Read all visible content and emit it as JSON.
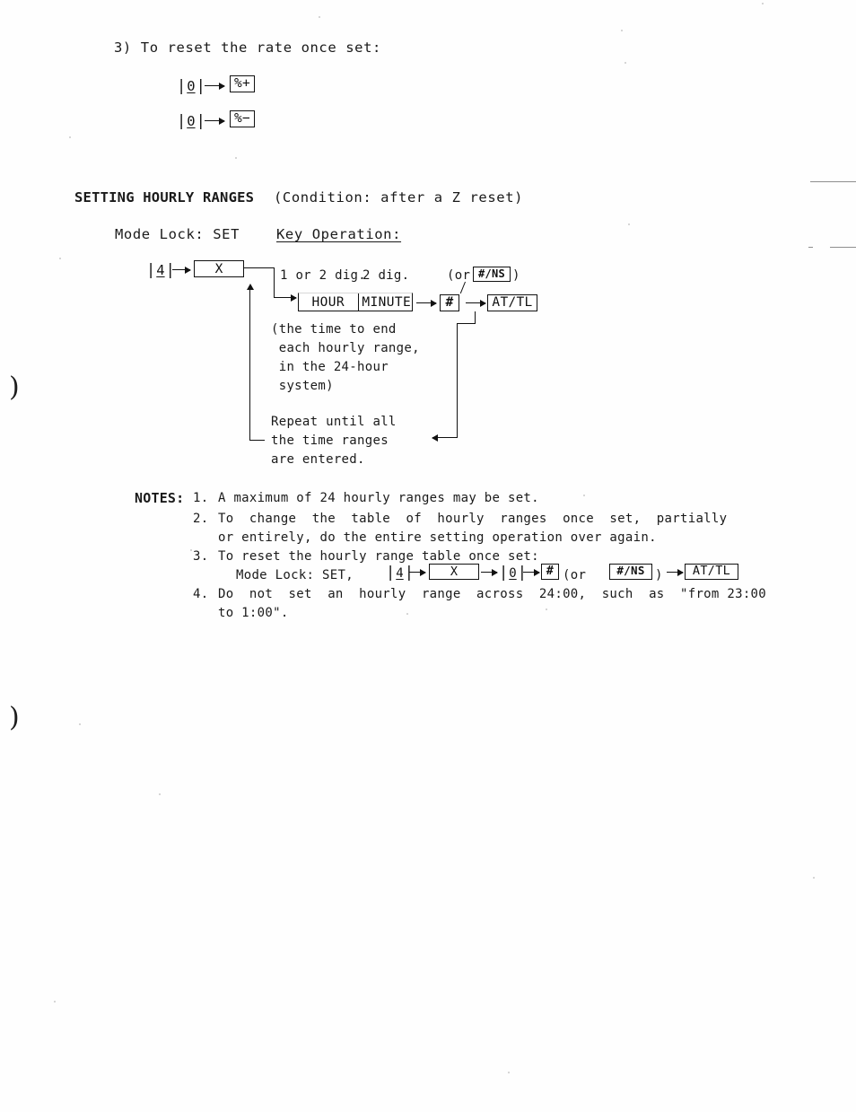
{
  "document": {
    "section_3": {
      "heading": "3) To reset the rate once set:",
      "lines": [
        {
          "key": "0",
          "arrow": "→",
          "target": "%+"
        },
        {
          "key": "0",
          "arrow": "→",
          "target": "%−"
        }
      ]
    },
    "section_hourly": {
      "title": "SETTING HOURLY RANGES",
      "condition": "(Condition: after a Z reset)",
      "mode_lock": "Mode Lock: SET",
      "key_operation_label": "Key Operation:",
      "diagram": {
        "start_key": "4",
        "x_box_label": "X",
        "digit_hint_1": "1 or 2 dig.",
        "digit_hint_2": "2 dig.",
        "or_note_open": "(or",
        "or_note_key": "#/NS",
        "or_note_close": ")",
        "hour_label": "HOUR",
        "minute_label": "MINUTE",
        "hash_key": "#",
        "attl_key": "AT/TL",
        "paren_note": [
          "(the time to end",
          " each hourly range,",
          " in the 24-hour",
          " system)"
        ],
        "repeat_note": [
          "Repeat until all",
          "the time ranges",
          "are entered."
        ]
      }
    },
    "notes": {
      "label": "NOTES:",
      "items": [
        {
          "number": "1.",
          "lines": [
            "A maximum of 24 hourly ranges may be set."
          ]
        },
        {
          "number": "2.",
          "lines": [
            "To  change  the  table  of  hourly  ranges  once  set,  partially",
            "or entirely, do the entire setting operation over again."
          ]
        },
        {
          "number": "3.",
          "lines": [
            "To reset the hourly range table once set:"
          ],
          "sequence": {
            "prefix": "Mode Lock: SET,",
            "key_4": "4",
            "x_box_label": "X",
            "key_0": "0",
            "hash_key": "#",
            "or_open": "(or",
            "or_key": "#/NS",
            "or_close": ")",
            "attl_key": "AT/TL",
            "arrow": "→"
          }
        },
        {
          "number": "4.",
          "lines": [
            "Do  not  set  an  hourly  range  across  24:00,  such  as  \"from 23:00",
            "to 1:00\"."
          ]
        }
      ]
    },
    "margin_marks": [
      ")",
      ")"
    ],
    "colors": {
      "ink": "#161616",
      "paper": "#fefefe",
      "edge_rule": "#8e8e8e"
    }
  }
}
